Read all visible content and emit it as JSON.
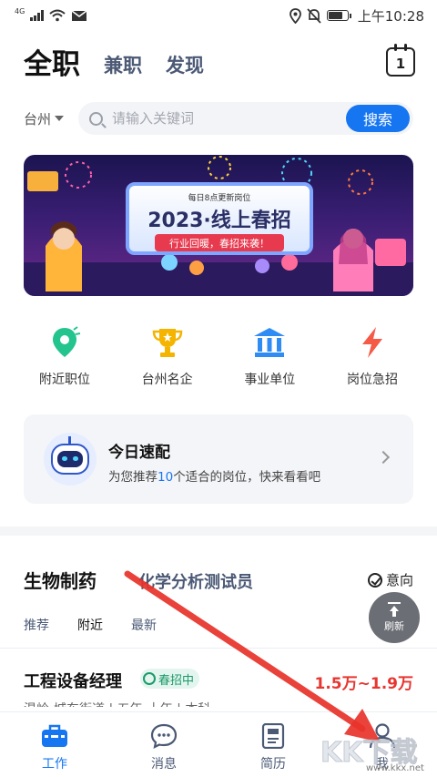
{
  "status_bar": {
    "network": "4G",
    "time": "上午10:28",
    "battery_level": 0.75
  },
  "top_tabs": [
    {
      "label": "全职",
      "active": true
    },
    {
      "label": "兼职",
      "active": false
    },
    {
      "label": "发现",
      "active": false
    }
  ],
  "calendar": {
    "day": "1",
    "icon": "calendar-icon"
  },
  "search": {
    "city": "台州",
    "placeholder": "请输入关键词",
    "button_label": "搜索"
  },
  "banner": {
    "subtitle": "每日8点更新岗位",
    "title": "2023·线上春招",
    "ribbon": "行业回暖，春招来袭！"
  },
  "quick_entries": [
    {
      "label": "附近职位",
      "icon": "location-pin-icon",
      "color": "#24c48e"
    },
    {
      "label": "台州名企",
      "icon": "trophy-icon",
      "color": "#f5b400"
    },
    {
      "label": "事业单位",
      "icon": "bank-icon",
      "color": "#2f8cf5"
    },
    {
      "label": "岗位急招",
      "icon": "lightning-icon",
      "color": "#f55a47"
    }
  ],
  "match_card": {
    "title": "今日速配",
    "desc_prefix": "为您推荐",
    "desc_count": "10",
    "desc_suffix": "个适合的岗位，快来看看吧"
  },
  "categories": {
    "active": "生物制药",
    "other": "化学分析测试员",
    "intent_label": "意向"
  },
  "sort_options": [
    {
      "label": "推荐",
      "active": false
    },
    {
      "label": "附近",
      "active": true
    },
    {
      "label": "最新",
      "active": false
    }
  ],
  "refresh_label": "刷新",
  "job": {
    "title": "工程设备经理",
    "badge": "春招中",
    "salary": "1.5万~1.9万",
    "meta": "温岭-城东街道 | 五年-十年 | 本科"
  },
  "bottom_nav": [
    {
      "label": "工作",
      "icon": "briefcase-icon",
      "active": true
    },
    {
      "label": "消息",
      "icon": "chat-bubble-icon",
      "active": false
    },
    {
      "label": "简历",
      "icon": "resume-icon",
      "active": false
    },
    {
      "label": "我",
      "icon": "user-profile-icon",
      "active": false
    }
  ],
  "watermark": {
    "text": "KK下载",
    "url": "www.kkx.net"
  },
  "colors": {
    "accent": "#1676f2",
    "salary": "#e8352f",
    "arrow": "#e8332a"
  }
}
